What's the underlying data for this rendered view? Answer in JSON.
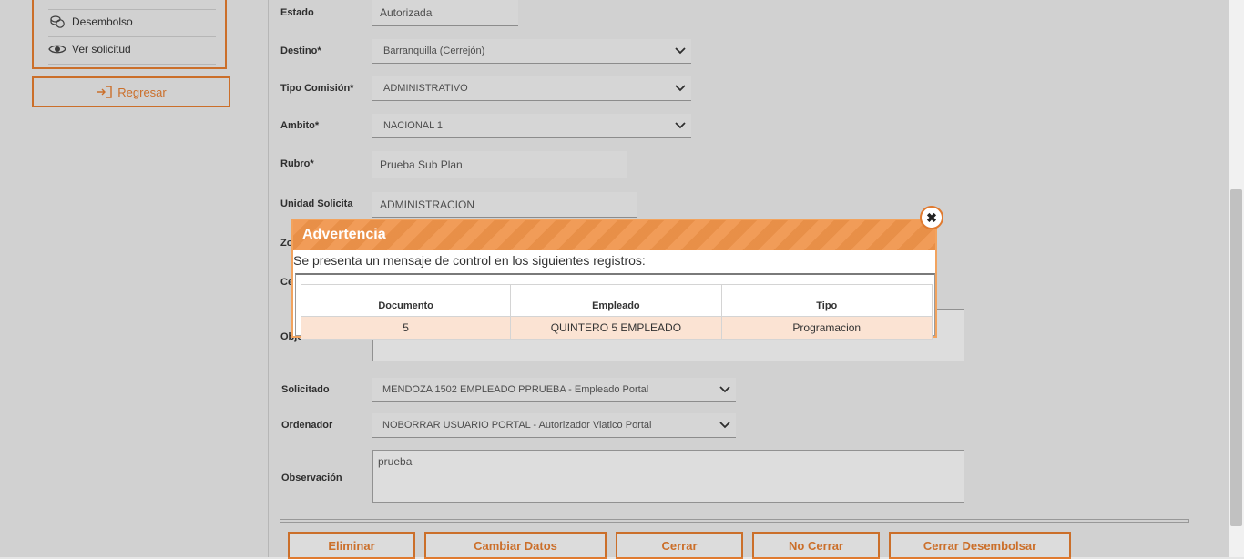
{
  "sidebar": {
    "items": [
      {
        "label": "Desembolso",
        "icon": "coins-icon"
      },
      {
        "label": "Ver solicitud",
        "icon": "eye-icon"
      }
    ],
    "back_label": "Regresar"
  },
  "form": {
    "estado": {
      "label": "Estado",
      "value": "Autorizada"
    },
    "destino": {
      "label": "Destino*",
      "value": "Barranquilla (Cerrejón)"
    },
    "tipo_comision": {
      "label": "Tipo Comisión*",
      "value": "ADMINISTRATIVO"
    },
    "ambito": {
      "label": "Ambito*",
      "value": "NACIONAL 1"
    },
    "rubro": {
      "label": "Rubro*",
      "value": "Prueba Sub Plan"
    },
    "unidad": {
      "label": "Unidad Solicita",
      "value": "ADMINISTRACION"
    },
    "zona_label_partial": "Zo",
    "centro_label_partial": "Ce",
    "objeto_label_partial": "Objeto",
    "solicitado": {
      "label": "Solicitado",
      "value": "MENDOZA 1502 EMPLEADO PPRUEBA - Empleado Portal"
    },
    "ordenador": {
      "label": "Ordenador",
      "value": "NOBORRAR USUARIO PORTAL - Autorizador Viatico Portal"
    },
    "observacion": {
      "label": "Observación",
      "value": "prueba"
    }
  },
  "buttons": {
    "eliminar": "Eliminar",
    "cambiar_datos": "Cambiar Datos",
    "cerrar": "Cerrar",
    "no_cerrar": "No Cerrar",
    "cerrar_desembolsar": "Cerrar Desembolsar"
  },
  "modal": {
    "title": "Advertencia",
    "message": "Se presenta un mensaje de control en los siguientes registros:",
    "columns": [
      "Documento",
      "Empleado",
      "Tipo"
    ],
    "rows": [
      [
        "5",
        "QUINTERO 5 EMPLEADO",
        "Programacion"
      ]
    ],
    "close_icon": "close-icon"
  },
  "colors": {
    "accent": "#e07a2f",
    "modal_header": "#f0944a",
    "row_highlight": "#fbe3d3"
  }
}
